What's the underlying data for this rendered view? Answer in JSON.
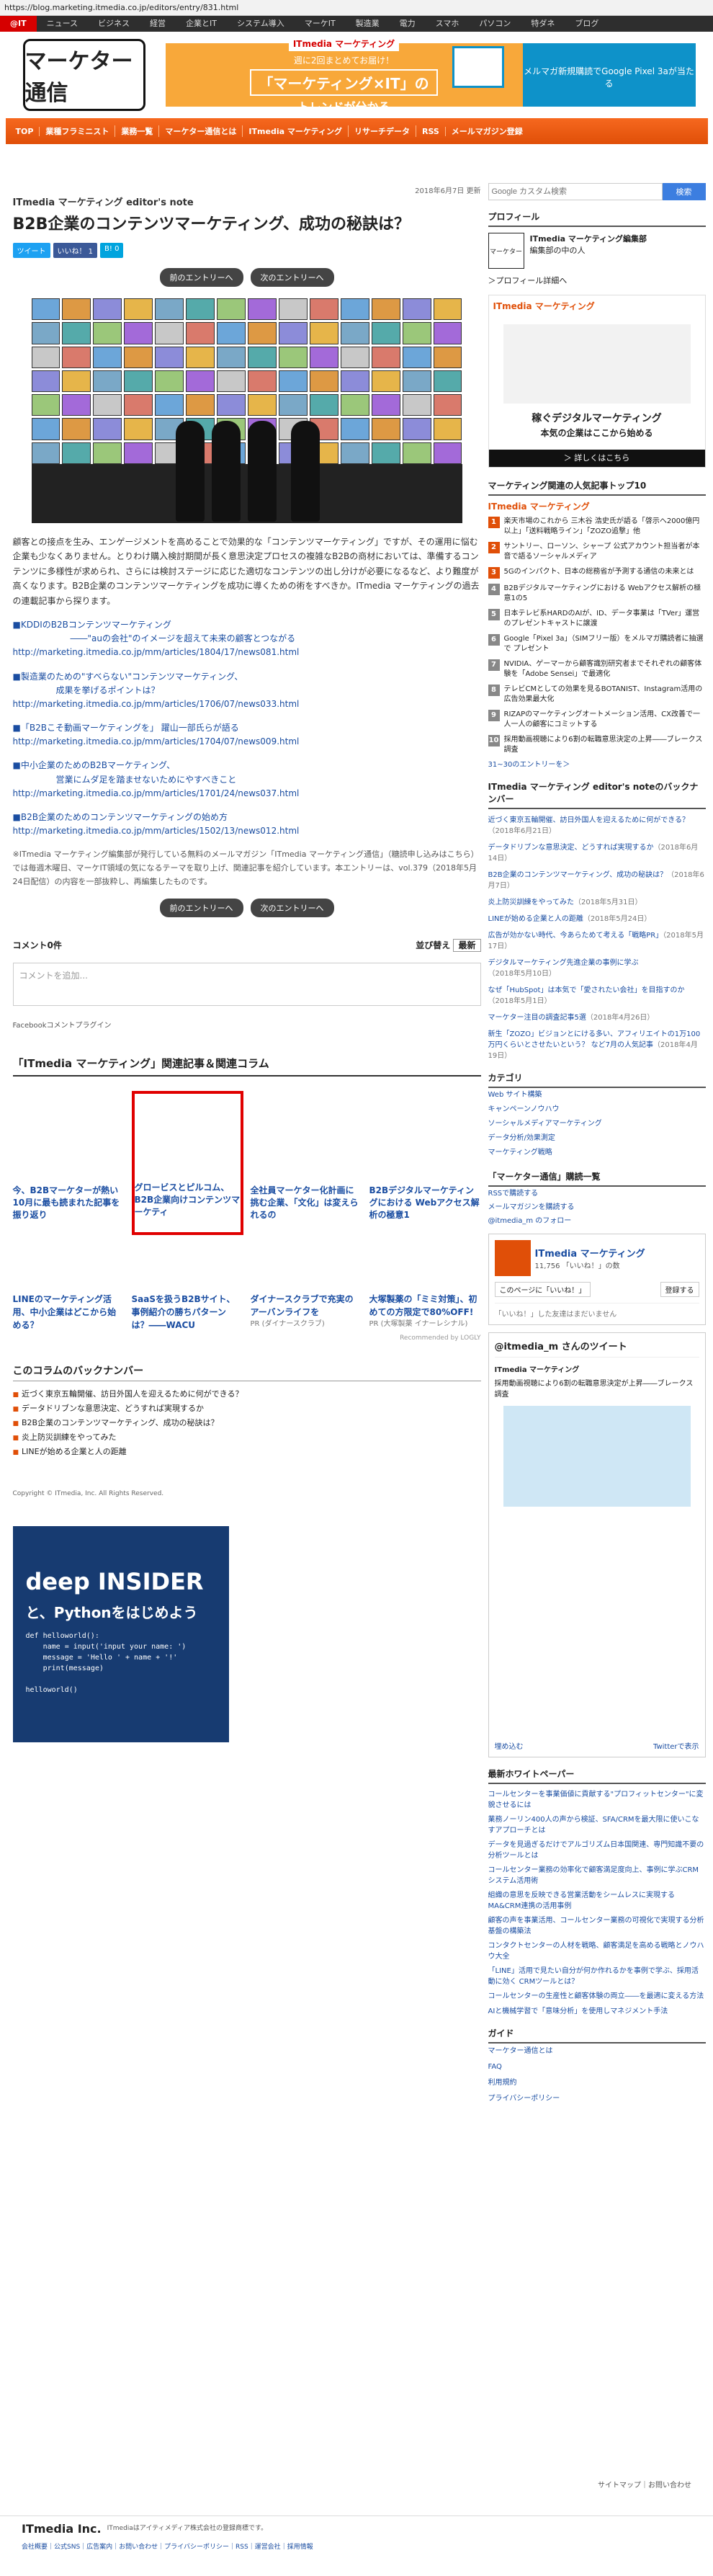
{
  "url": "https://blog.marketing.itmedia.co.jp/editors/entry/831.html",
  "top_nav": [
    "@IT",
    "ニュース",
    "ビジネス",
    "経営",
    "企業とIT",
    "システム導入",
    "マーケIT",
    "製造業",
    "電力",
    "スマホ",
    "パソコン",
    "特ダネ",
    "ブログ"
  ],
  "logo": "マーケター通信",
  "banner": {
    "brand": "ITmedia マーケティング",
    "sub": "週に2回まとめてお届け！",
    "main": "「マーケティング×IT」の",
    "main2": "トレンドが分かる",
    "right": "メルマガ新規購読でGoogle Pixel 3aが当たる"
  },
  "main_nav": [
    "TOP",
    "業種フラミニスト",
    "業務一覧",
    "マーケター通信とは",
    "ITmedia マーケティング",
    "リサーチデータ",
    "RSS",
    "メールマガジン登録"
  ],
  "article": {
    "date": "2018年6月7日 更新",
    "eyebrow": "ITmedia マーケティング editor's note",
    "title": "B2B企業のコンテンツマーケティング、成功の秘訣は？",
    "share": [
      "ツイート",
      "いいね！ 1",
      "B! 0"
    ],
    "prev": "前のエントリーへ",
    "next": "次のエントリーへ",
    "body": "顧客との接点を生み、エンゲージメントを高めることで効果的な「コンテンツマーケティング」ですが、その運用に悩む企業も少なくありません。とりわけ購入検討期間が長く意思決定プロセスの複雑なB2Bの商材においては、準備するコンテンツに多様性が求められ、さらには検討ステージに応じた適切なコンテンツの出し分けが必要になるなど、より難度が高くなります。B2B企業のコンテンツマーケティングを成功に導くための術をすべきか。ITmedia マーケティングの過去の連載記事から探ります。",
    "links": [
      {
        "t": "■KDDIのB2Bコンテンツマーケティング",
        "s": "――\"auの会社\"のイメージを超えて未来の顧客とつながる",
        "u": "http://marketing.itmedia.co.jp/mm/articles/1804/17/news081.html"
      },
      {
        "t": "■製造業のための\"すべらない\"コンテンツマーケティング、",
        "s": "成果を挙げるポイントは？",
        "u": "http://marketing.itmedia.co.jp/mm/articles/1706/07/news033.html"
      },
      {
        "t": "■「B2Bこそ動画マーケティングを」 躍山一部氏らが語る",
        "s": "",
        "u": "http://marketing.itmedia.co.jp/mm/articles/1704/07/news009.html"
      },
      {
        "t": "■中小企業のためのB2Bマーケティング、",
        "s": "営業にムダ足を踏ませないためにやすべきこと",
        "u": "http://marketing.itmedia.co.jp/mm/articles/1701/24/news037.html"
      },
      {
        "t": "■B2B企業のためのコンテンツマーケティングの始め方",
        "s": "",
        "u": "http://marketing.itmedia.co.jp/mm/articles/1502/13/news012.html"
      }
    ],
    "note": "※ITmedia マーケティング編集部が発行している無料のメールマガジン「ITmedia マーケティング通信」（糖読申し込みはこちら）では毎週木曜日、マーケIT領域の気になるテーマを取り上げ、関連記事を紹介しています。本エントリーは、vol.379（2018年5月24日配信）の内容を一部抜粋し、再編集したものです。"
  },
  "comments": {
    "count": "コメント0件",
    "sort_label": "並び替え",
    "sort_value": "最新",
    "placeholder": "コメントを追加...",
    "plugin": "Facebookコメントプラグイン"
  },
  "related": {
    "title": "「ITmedia マーケティング」関連記事＆関連コラム",
    "row1": [
      "今、B2Bマーケターが熱い 10月に最も読まれた記事を振り返り",
      "グロービスとピルコム、B2B企業向けコンテンツマーケティ",
      "全社員マーケター化計画に挑む企業、「文化」は変えられるの",
      "B2Bデジタルマーケティングにおける Webアクセス解析の極意1"
    ],
    "row2": [
      "LINEのマーケティング活用、中小企業はどこから始める？",
      "SaaSを扱うB2Bサイト、事例紹介の勝ちパターンは？――WACU",
      "ダイナースクラブで充実のアーバンライフを",
      "大塚製薬の「ミミ対策」、初めての方限定で80%OFF!"
    ],
    "row2_src": [
      "",
      "",
      "PR (ダイナースクラブ)",
      "PR (大塚製薬 イナーレシナル)"
    ],
    "recommend": "Recommended by LOGLY"
  },
  "backnumber": {
    "title": "このコラムのバックナンバー",
    "items": [
      "近づく東京五輪開催、訪日外国人を迎えるために何ができる？",
      "データドリブンな意思決定、どうすれば実現するか",
      "B2B企業のコンテンツマーケティング、成功の秘訣は？",
      "炎上防災訓練をやってみた",
      "LINEが始める企業と人の距離"
    ]
  },
  "copyright": "Copyright © ITmedia, Inc. All Rights Reserved.",
  "deep_ad": {
    "brand": "deep INSIDER",
    "lead": "と、Pythonをはじめよう",
    "code": "def helloworld():\n    name = input('input your name: ')\n    message = 'Hello ' + name + '!'\n    print(message)\n\nhelloworld()"
  },
  "sidebar": {
    "search_placeholder": "Google カスタム検索",
    "search_button": "検索",
    "profile_head": "プロフィール",
    "profile_name": "ITmedia マーケティング編集部",
    "profile_role": "編集部の中の人",
    "profile_img": "マーケター",
    "profile_more": "＞プロフィール詳細へ",
    "ad_logo": "ITmedia マーケティング",
    "ad_cap1": "稼ぐデジタルマーケティング",
    "ad_cap2": "本気の企業はここから始める",
    "ad_cta": "＞ 詳しくはこちら",
    "rank_title": "マーケティング関連の人気記事トップ10",
    "rank_logo": "ITmedia マーケティング",
    "rank": [
      "楽天市場のこれから 三木谷 浩史氏が語る「啓示へ2000億円以上」「送料戦略ライン」「ZOZO追撃」他",
      "サントリー、ローソン、シャープ 公式アカウント担当者が本音で語るソーシャルメディア",
      "5Gのインパクト、日本の総務省が予測する通信の未来とは",
      "B2Bデジタルマーケティングにおける Webアクセス解析の極意1の5",
      "日本テレビ系HARDのAIが、ID、データ事業は「TVer」運営のプレゼントキャストに譲渡",
      "Google「Pixel 3a」（SIMフリー版）をメルマガ購読者に抽選で プレゼント",
      "NVIDIA、ゲーマーから顧客識別研究者までそれぞれの顧客体験を「Adobe Sensei」で最適化",
      "テレビCMとしての効果を見るBOTANIST、Instagram活用の広告効果最大化",
      "RIZAPのマーケティングオートメーション活用、CX改善で一人一人の顧客にコミットする",
      "採用動画視聴により6割の転職意思決定の上昇――ブレークス調査"
    ],
    "rank_more": "31~30のエントリーを＞",
    "back_head": "ITmedia マーケティング editor's noteのバックナンバー",
    "back": [
      {
        "t": "近づく東京五輪開催、訪日外国人を迎えるために何ができる？",
        "d": "（2018年6月21日）"
      },
      {
        "t": "データドリブンな意思決定、どうすれば実現するか",
        "d": "（2018年6月14日）"
      },
      {
        "t": "B2B企業のコンテンツマーケティング、成功の秘訣は？",
        "d": "（2018年6月7日）"
      },
      {
        "t": "炎上防災訓練をやってみた",
        "d": "（2018年5月31日）"
      },
      {
        "t": "LINEが始める企業と人の距離",
        "d": "（2018年5月24日）"
      },
      {
        "t": "広告が効かない時代、今あらためて考える「戦略PR」",
        "d": "（2018年5月17日）"
      },
      {
        "t": "デジタルマーケティング先進企業の事例に学ぶ",
        "d": "（2018年5月10日）"
      },
      {
        "t": "なぜ「HubSpot」は本気で「愛されたい会社」を目指すのか",
        "d": "（2018年5月1日）"
      },
      {
        "t": "マーケター注目の調査記事5選",
        "d": "（2018年4月26日）"
      },
      {
        "t": "新生「ZOZO」ビジョンとにける多い、アフィリエイトの1万100万円くらいとさせたいという？ など7月の人気記事",
        "d": "（2018年4月19日）"
      }
    ],
    "cat_head": "カテゴリ",
    "categories": [
      "Web サイト構築",
      "キャンペーンノウハウ",
      "ソーシャルメディアマーケティング",
      "データ分析/効果測定",
      "マーケティング戦略"
    ],
    "follow_head": "「マーケター通信」購読一覧",
    "follow": [
      "RSSで購読する",
      "メールマガジンを購読する",
      "@itmedia_m のフォロー"
    ],
    "fb_name": "ITmedia マーケティング",
    "fb_likes": "11,756 「いいね！」の数",
    "fb_like_btn": "このページに「いいね！」",
    "fb_signup": "登録する",
    "fb_msg": "「いいね！」した友達はまだいません",
    "tw_head": "@itmedia_m さんのツイート",
    "tw_user": "ITmedia マーケティング",
    "tw_text": "採用動画視聴により6割の転職意思決定が上昇――ブレークス調査",
    "tw_embed": "Twitterで表示",
    "tw_embed_left": "埋め込む",
    "wp_head": "最新ホワイトペーパー",
    "wp": [
      "コールセンターを事業価値に貢献する\"プロフィットセンター\"に変貌させるには",
      "業務ノーリン400人の声から検証、SFA/CRMを最大限に使いこなすアプローチとは",
      "データを見過ぎるだけでアルゴリズム日本国関連、専門知識不要の分析ツールとは",
      "コールセンター業務の効率化で顧客満足度向上、事例に学ぶCRMシステム活用術",
      "組織の意思を反映できる営業活動をシームレスに実現するMA&CRM連携の活用事例",
      "顧客の声を事業活用、コールセンター業務の可視化で実現する分析基盤の構築法",
      "コンタクトセンターの人材を戦略、顧客満足を高める戦略とノウハウ大全",
      "「LINE」活用で見たい自分が何か作れるかを事例で学ぶ、採用活動に効く CRMツールとは？",
      "コールセンターの生産性と顧客体験の両立――を最適に変える方法",
      "AIと機械学習で「意味分析」を使用しマネジメント手法"
    ],
    "guide_head": "ガイド",
    "guide": [
      "マーケター通信とは",
      "FAQ",
      "利用規約",
      "プライバシーポリシー"
    ]
  },
  "footer": {
    "top": "サイトマップ｜お問い合わせ",
    "company": "ITmedia Inc.",
    "note": "ITmediaはアイティメディア株式会社の登録商標です。",
    "links": "会社概要｜公式SNS｜広告案内｜お問い合わせ｜プライバシーポリシー｜RSS｜運営会社｜採用情報"
  }
}
